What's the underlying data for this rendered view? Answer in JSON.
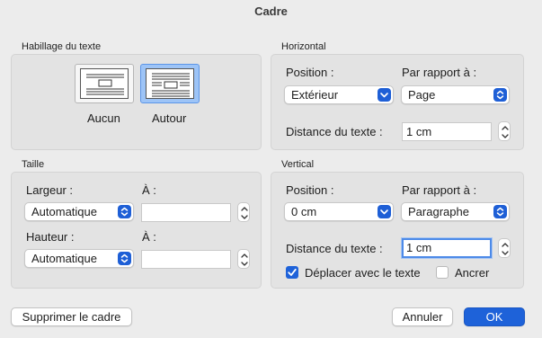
{
  "window": {
    "title": "Cadre"
  },
  "wrapping": {
    "group_label": "Habillage du texte",
    "options": [
      {
        "label": "Aucun",
        "selected": false,
        "icon": "wrap-none-icon"
      },
      {
        "label": "Autour",
        "selected": true,
        "icon": "wrap-around-icon"
      }
    ]
  },
  "horizontal": {
    "group_label": "Horizontal",
    "position_label": "Position :",
    "position_value": "Extérieur",
    "relative_label": "Par rapport à :",
    "relative_value": "Page",
    "distance_label": "Distance du texte :",
    "distance_value": "1 cm"
  },
  "size": {
    "group_label": "Taille",
    "width_label": "Largeur :",
    "width_value": "Automatique",
    "width_at_label": "À :",
    "width_at_value": "",
    "height_label": "Hauteur :",
    "height_value": "Automatique",
    "height_at_label": "À :",
    "height_at_value": ""
  },
  "vertical": {
    "group_label": "Vertical",
    "position_label": "Position :",
    "position_value": "0 cm",
    "relative_label": "Par rapport à :",
    "relative_value": "Paragraphe",
    "distance_label": "Distance du texte :",
    "distance_value": "1 cm",
    "move_with_text_label": "Déplacer avec le texte",
    "move_with_text_checked": true,
    "anchor_label": "Ancrer",
    "anchor_checked": false
  },
  "footer": {
    "remove_label": "Supprimer le cadre",
    "cancel_label": "Annuler",
    "ok_label": "OK"
  },
  "colors": {
    "accent": "#1e62d9",
    "selected_tile": "#9dc4f7",
    "panel": "#e3e3e3",
    "background": "#ececec"
  }
}
